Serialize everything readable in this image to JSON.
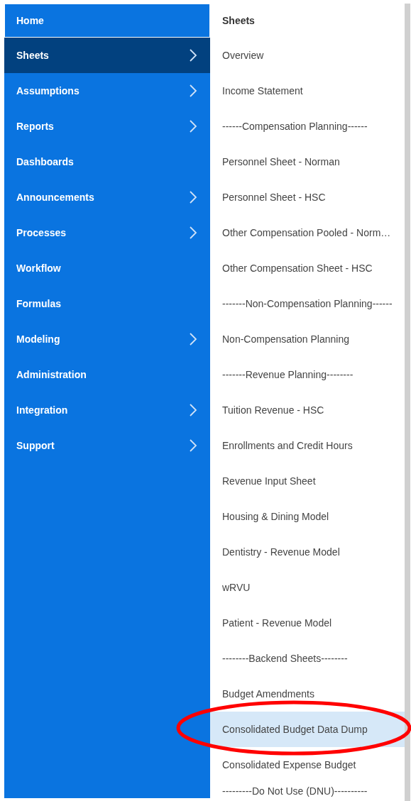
{
  "nav": [
    {
      "label": "Home",
      "selected": false,
      "focused": true,
      "has_submenu": false
    },
    {
      "label": "Sheets",
      "selected": true,
      "focused": false,
      "has_submenu": true
    },
    {
      "label": "Assumptions",
      "selected": false,
      "focused": false,
      "has_submenu": true
    },
    {
      "label": "Reports",
      "selected": false,
      "focused": false,
      "has_submenu": true
    },
    {
      "label": "Dashboards",
      "selected": false,
      "focused": false,
      "has_submenu": false
    },
    {
      "label": "Announcements",
      "selected": false,
      "focused": false,
      "has_submenu": true
    },
    {
      "label": "Processes",
      "selected": false,
      "focused": false,
      "has_submenu": true
    },
    {
      "label": "Workflow",
      "selected": false,
      "focused": false,
      "has_submenu": false
    },
    {
      "label": "Formulas",
      "selected": false,
      "focused": false,
      "has_submenu": false
    },
    {
      "label": "Modeling",
      "selected": false,
      "focused": false,
      "has_submenu": true
    },
    {
      "label": "Administration",
      "selected": false,
      "focused": false,
      "has_submenu": false
    },
    {
      "label": "Integration",
      "selected": false,
      "focused": false,
      "has_submenu": true
    },
    {
      "label": "Support",
      "selected": false,
      "focused": false,
      "has_submenu": true
    }
  ],
  "submenu": {
    "title": "Sheets",
    "items": [
      {
        "label": "Overview",
        "selected": false
      },
      {
        "label": "Income Statement",
        "selected": false
      },
      {
        "label": "------Compensation Planning------",
        "selected": false
      },
      {
        "label": "Personnel Sheet - Norman",
        "selected": false
      },
      {
        "label": "Personnel Sheet - HSC",
        "selected": false
      },
      {
        "label": "Other Compensation Pooled - Norm…",
        "selected": false
      },
      {
        "label": "Other Compensation Sheet - HSC",
        "selected": false
      },
      {
        "label": "-------Non-Compensation Planning------",
        "selected": false
      },
      {
        "label": "Non-Compensation Planning",
        "selected": false
      },
      {
        "label": "-------Revenue Planning--------",
        "selected": false
      },
      {
        "label": "Tuition Revenue - HSC",
        "selected": false
      },
      {
        "label": "Enrollments and Credit Hours",
        "selected": false
      },
      {
        "label": "Revenue Input Sheet",
        "selected": false
      },
      {
        "label": "Housing & Dining Model",
        "selected": false
      },
      {
        "label": "Dentistry - Revenue Model",
        "selected": false
      },
      {
        "label": "wRVU",
        "selected": false
      },
      {
        "label": "Patient - Revenue Model",
        "selected": false
      },
      {
        "label": "--------Backend Sheets--------",
        "selected": false
      },
      {
        "label": "Budget Amendments",
        "selected": false
      },
      {
        "label": "Consolidated Budget Data Dump",
        "selected": true
      },
      {
        "label": "Consolidated Expense Budget",
        "selected": false
      },
      {
        "label": "---------Do Not Use (DNU)----------",
        "selected": false
      }
    ]
  },
  "annotation": {
    "kind": "ellipse"
  }
}
